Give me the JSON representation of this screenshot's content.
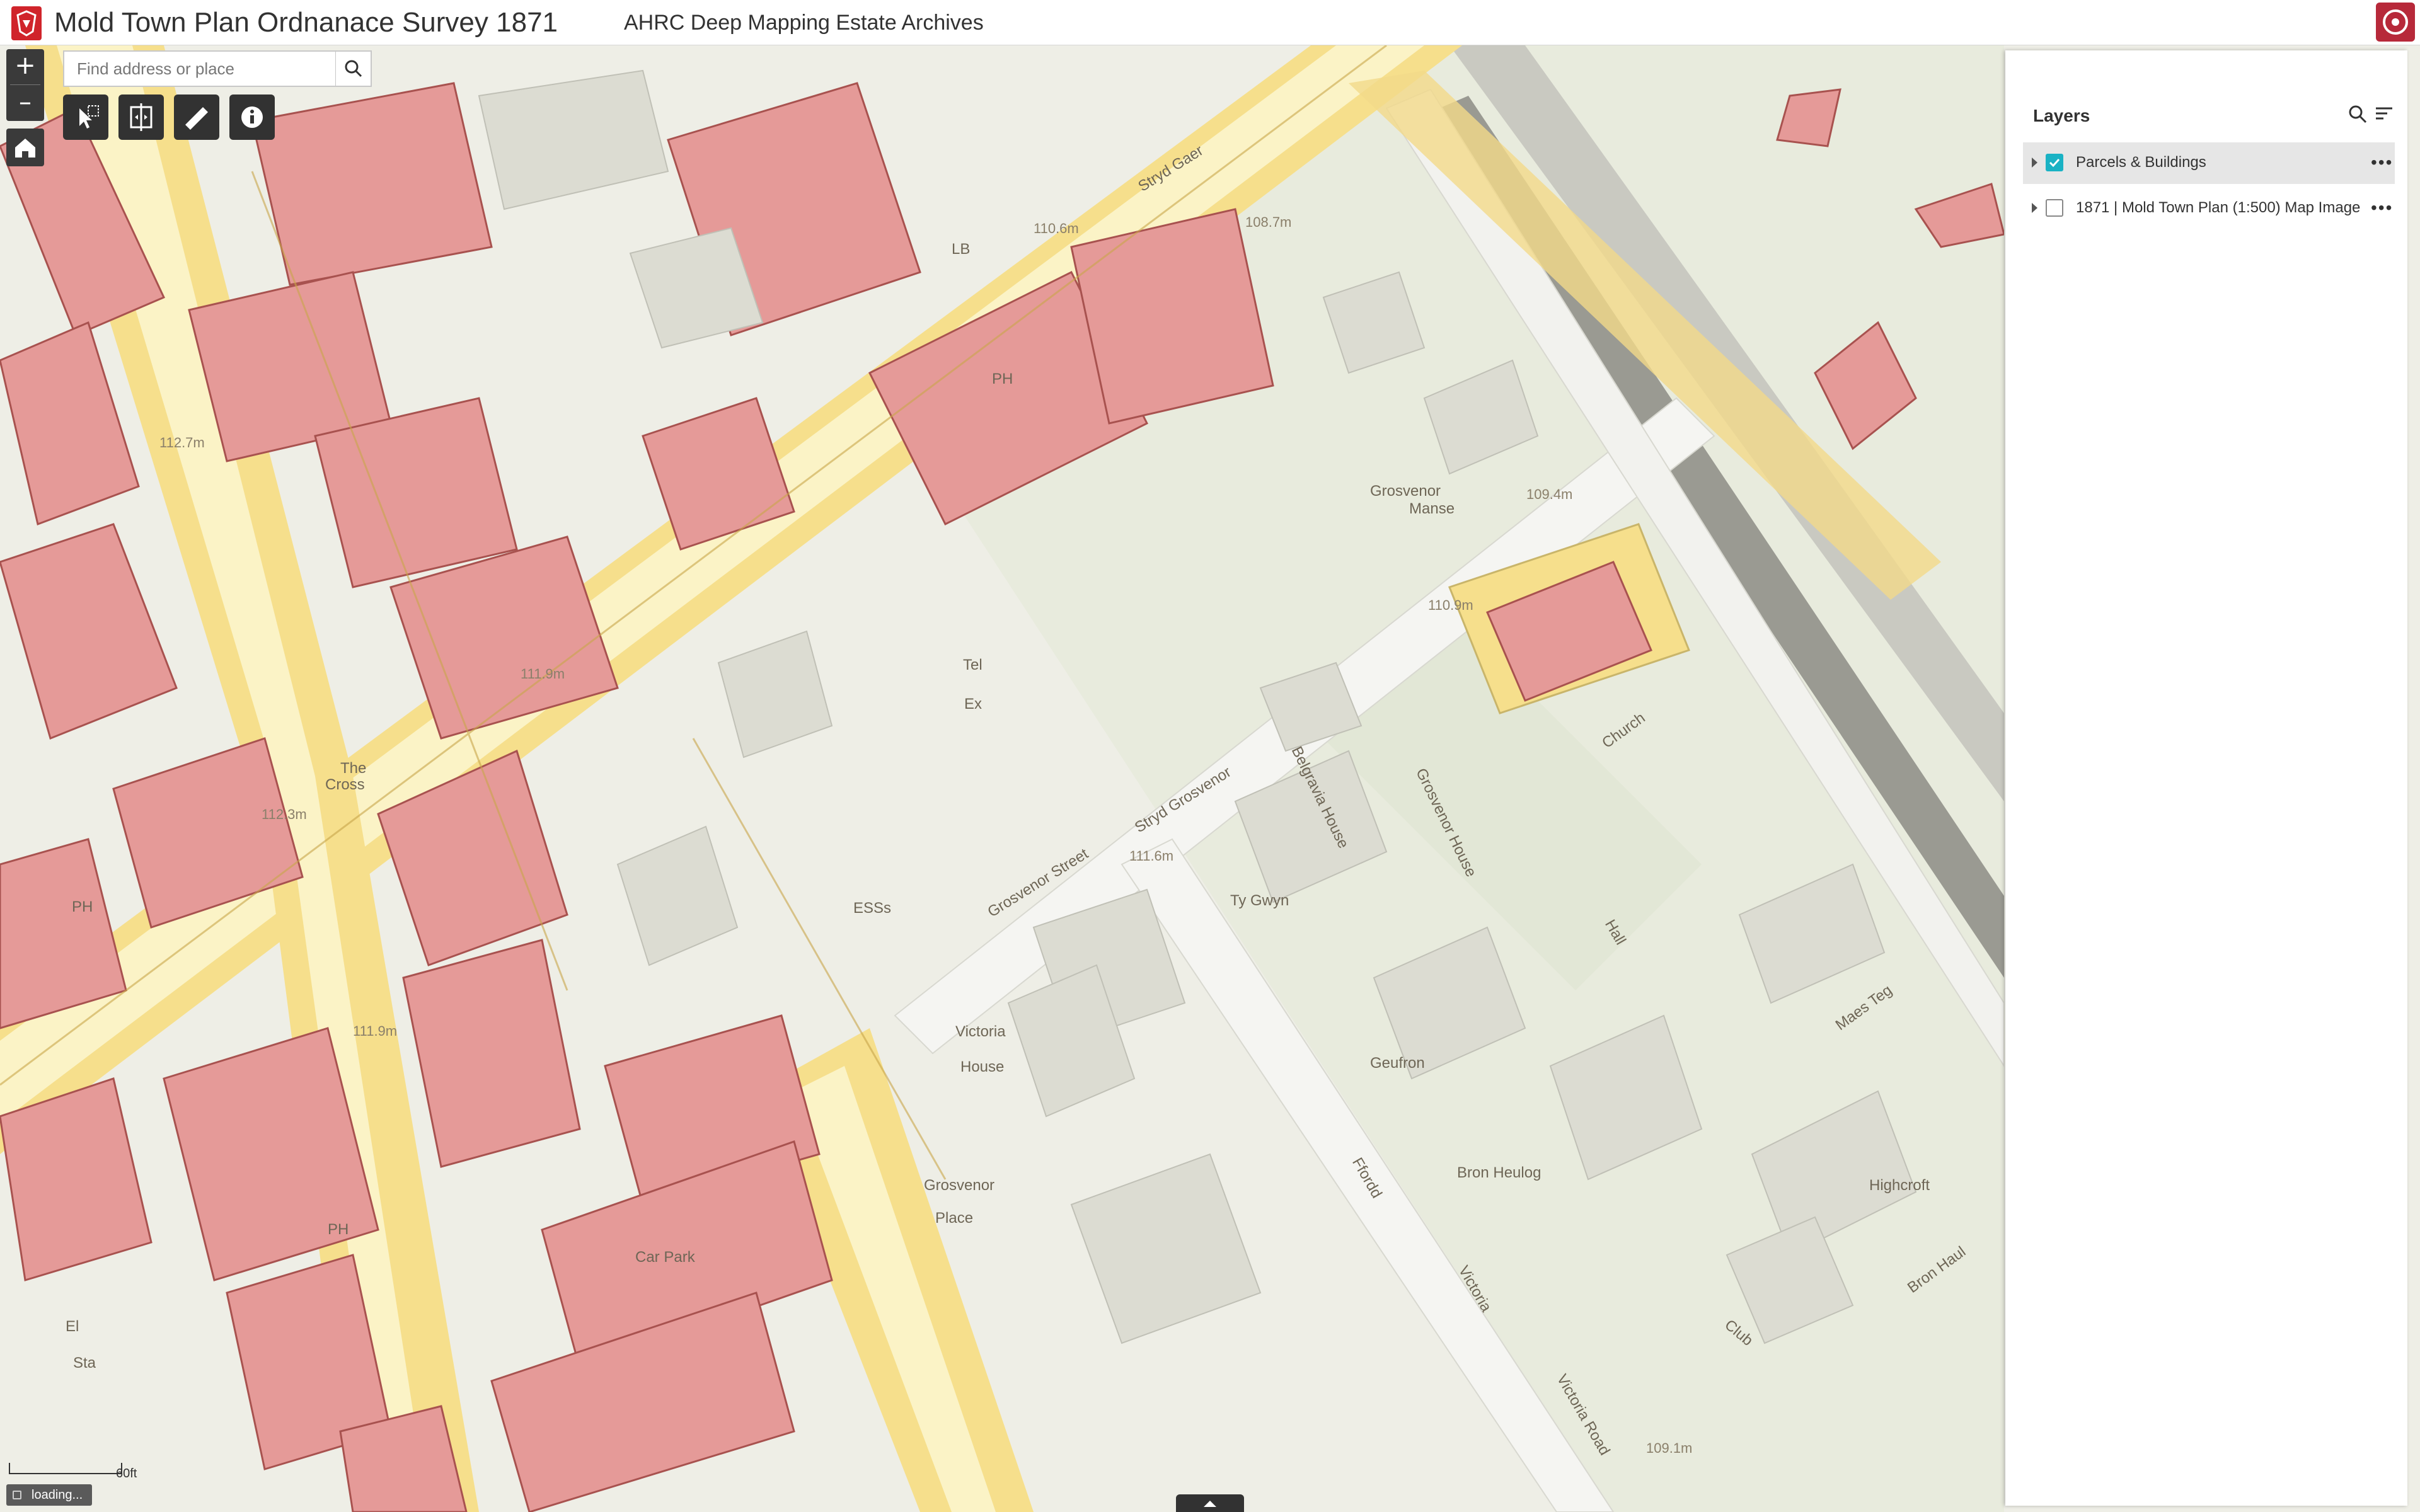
{
  "header": {
    "title": "Mold Town Plan Ordnanace Survey 1871",
    "subtitle": "AHRC Deep Mapping Estate Archives"
  },
  "search": {
    "placeholder": "Find address or place"
  },
  "zoom": {
    "in_label": "+",
    "out_label": "–"
  },
  "tools": [
    {
      "name": "select-tool",
      "icon": "cursor-select-icon"
    },
    {
      "name": "swipe-tool",
      "icon": "swipe-icon"
    },
    {
      "name": "measure-tool",
      "icon": "ruler-icon"
    },
    {
      "name": "info-tool",
      "icon": "info-icon"
    }
  ],
  "layers_panel": {
    "title": "Layers",
    "items": [
      {
        "label": "Parcels & Buildings",
        "checked": true,
        "more": "•••"
      },
      {
        "label": "1871 | Mold Town Plan (1:500) Map Image",
        "checked": false,
        "more": "•••"
      }
    ]
  },
  "map": {
    "labels": {
      "spot_112_7": "112.7m",
      "spot_112_3": "112.3m",
      "spot_111_9a": "111.9m",
      "spot_111_9b": "111.9m",
      "spot_110_6": "110.6m",
      "spot_108_7": "108.7m",
      "spot_109_4": "109.4m",
      "spot_110_9": "110.9m",
      "spot_111_6": "111.6m",
      "spot_109_1": "109.1m",
      "the_cross_1": "The",
      "the_cross_2": "Cross",
      "grosvenor_manse_1": "Grosvenor",
      "grosvenor_manse_2": "Manse",
      "stryd_grosvenor": "Stryd Grosvenor",
      "grosvenor_street": "Grosvenor Street",
      "victoria_house_1": "Victoria",
      "victoria_house_2": "House",
      "grosvenor_place_1": "Grosvenor",
      "grosvenor_place_2": "Place",
      "ty_gwyn": "Ty Gwyn",
      "geufron": "Geufron",
      "bron_heulog": "Bron Heulog",
      "highcroft": "Highcroft",
      "bron_haul": "Bron Haul",
      "club": "Club",
      "maes_teg": "Maes Teg",
      "hall": "Hall",
      "church": "Church",
      "belgravia_house": "Belgravia House",
      "grosvenor_house": "Grosvenor House",
      "ffordd": "Ffordd",
      "victoria": "Victoria",
      "victoria_road": "Victoria Road",
      "car_park": "Car Park",
      "ph_1": "PH",
      "ph_2": "PH",
      "ph_3": "PH",
      "lb": "LB",
      "ess": "ESSs",
      "tel_ex_1": "Tel",
      "tel_ex_2": "Ex",
      "el": "El",
      "sta": "Sta",
      "stryd_gaer": "Stryd Gaer"
    }
  },
  "scale": {
    "label": "60ft"
  },
  "status": {
    "loading": "loading..."
  },
  "colors": {
    "header_bg": "#ffffff",
    "accent": "#1ab2c4",
    "building": "#e59a98",
    "parcel": "#f8e08e",
    "road": "#fbf3c6",
    "ground": "#eeeee6",
    "logo": "#d0242b"
  }
}
